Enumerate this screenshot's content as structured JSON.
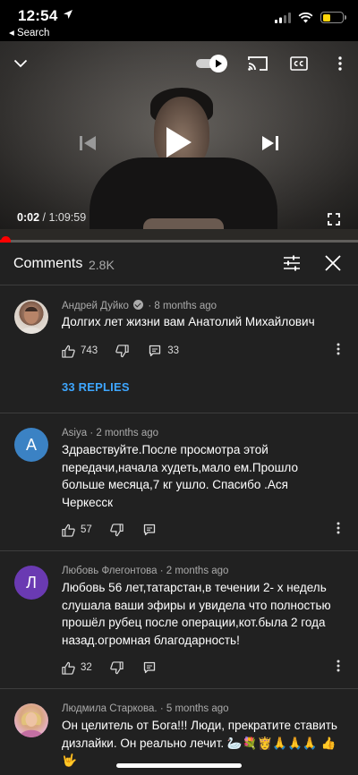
{
  "status_bar": {
    "time": "12:54",
    "back_label": "◂ Search"
  },
  "player": {
    "current_time": "0:02",
    "separator": " / ",
    "duration": "1:09:59",
    "progress": 0.0005,
    "autoplay_on": true
  },
  "comments_panel": {
    "title": "Comments",
    "count": "2.8K"
  },
  "comments": [
    {
      "author": "Андрей Дуйко",
      "verified": true,
      "age": "8 months ago",
      "text": "Долгих лет жизни вам Анатолий Михайлович",
      "likes": "743",
      "replies_count": "33",
      "replies_label": "33 REPLIES",
      "avatar_type": "photo"
    },
    {
      "author": "Asiya",
      "age": "2 months ago",
      "text": "Здравствуйте.После просмотра этой передачи,начала худеть,мало ем.Прошло больше месяца,7 кг ушло. Спасибо .Ася Черкесск",
      "likes": "57",
      "avatar_letter": "A",
      "avatar_color": "#3b82c4"
    },
    {
      "author": "Любовь Флегонтова",
      "age": "2 months ago",
      "text": "Любовь 56 лет,татарстан,в течении 2- х недель слушала ваши эфиры и  увидела что полностью прошёл рубец после операции,кот.была 2 года назад.огромная благодарность!",
      "likes": "32",
      "avatar_letter": "Л",
      "avatar_color": "#6a3ab2"
    },
    {
      "author": "Людмила Старкова.",
      "age": "5 months ago",
      "text": "Он целитель от Бога!!! Люди, прекратите ставить дизлайки. Он реально лечит. 🦢💐👸🙏🙏🙏 👍🤟",
      "avatar_type": "photo"
    }
  ],
  "colors": {
    "accent_red": "#ff0000",
    "link_blue": "#3ea6ff",
    "background": "#212121"
  },
  "icons": [
    "location-arrow-icon",
    "signal-icon",
    "wifi-icon",
    "battery-icon",
    "chevron-down-icon",
    "autoplay-toggle-icon",
    "cast-icon",
    "captions-icon",
    "more-vert-icon",
    "skip-previous-icon",
    "play-icon",
    "skip-next-icon",
    "fullscreen-icon",
    "filter-icon",
    "close-icon",
    "thumb-up-icon",
    "thumb-down-icon",
    "reply-icon"
  ]
}
